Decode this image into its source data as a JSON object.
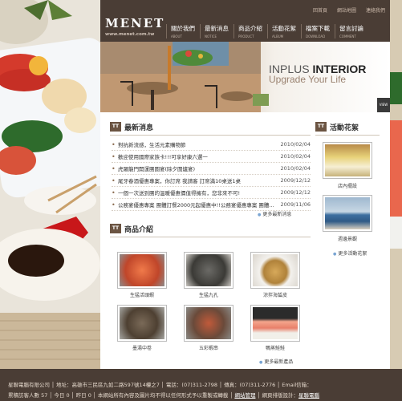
{
  "top_links": [
    "回首頁",
    "網站地圖",
    "連絡我們"
  ],
  "logo": {
    "name": "MENET",
    "url": "www.menet.com.tw"
  },
  "nav": [
    {
      "label": "關於我們",
      "sub": "ABOUT"
    },
    {
      "label": "最新消息",
      "sub": "NOTICE"
    },
    {
      "label": "商品介紹",
      "sub": "PRODUCT"
    },
    {
      "label": "活動花絮",
      "sub": "ALBUM"
    },
    {
      "label": "檔案下載",
      "sub": "DOWNLOAD"
    },
    {
      "label": "留言討論",
      "sub": "COMMENT"
    }
  ],
  "hero": {
    "line1_a": "INPLUS ",
    "line1_b": "INTERIOR",
    "line2": "Upgrade Your Life"
  },
  "news": {
    "title": "最新消息",
    "items": [
      {
        "title": "對抗新流感，生活元素購物節",
        "date": "2010/02/04"
      },
      {
        "title": "歡迎使用國際家族卡!!!可享好康六選一",
        "date": "2010/02/04"
      },
      {
        "title": "虎躍龍門開運團圓宴(除夕圍爐宴)",
        "date": "2010/02/04"
      },
      {
        "title": "尾牙春酒優惠專案，你訂席 我請客 訂席滿10桌送1桌",
        "date": "2009/12/12"
      },
      {
        "title": "一個一次送到團的溫暖優惠價值得擁有，您非來不可!",
        "date": "2009/12/12"
      },
      {
        "title": "公務宴優惠專案 團體訂餐2000元起優惠中!!公務宴優惠專案 團體...",
        "date": "2009/11/06"
      }
    ],
    "more": "更多最新消息"
  },
  "products": {
    "title": "商品介紹",
    "items": [
      {
        "caption": "生猛活頭蝦"
      },
      {
        "caption": "生猛九孔"
      },
      {
        "caption": "涼拌海蜇皮"
      },
      {
        "caption": "墨湯中卷"
      },
      {
        "caption": "五彩蝦串"
      },
      {
        "caption": "鴨蒸鮭鮭"
      }
    ],
    "more": "更多最新產品"
  },
  "album": {
    "title": "活動花絮",
    "items": [
      {
        "caption": "店內擺設"
      },
      {
        "caption": "週邊景觀"
      }
    ],
    "more": "更多活動花絮"
  },
  "footer": {
    "line1": "星聯電腦有限公司 │ 地址：高雄市三民區九如二路597號14樓之7 │ 電話：(07)311-2798 │ 傳真：(07)311-2776 │ Email信箱：",
    "line2a": "累積訪客人數 57 │ 今日 0 │ 昨日 0 │ 本網站所有內容及圖片均不得以任何形式予以重製或轉載 │ ",
    "admin": "網站管理",
    "line2b": " │ 網頁排版設計：",
    "designer": "星聯電腦"
  },
  "colors": {
    "header_bg": "#4a3d35",
    "accent": "#6b5442",
    "more_bullet": "#7aa5d3"
  }
}
